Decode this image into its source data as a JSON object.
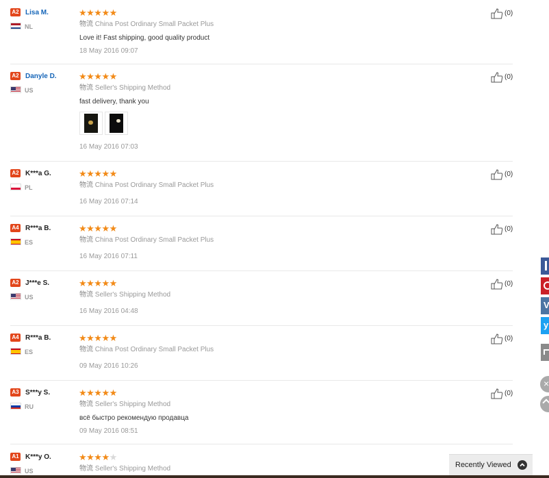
{
  "reviews": [
    {
      "level": "A2",
      "name": "Lisa M.",
      "name_link": true,
      "country": "NL",
      "flag": "nl",
      "rating": 5,
      "shipping_prefix": "物流",
      "shipping": "China Post Ordinary Small Packet Plus",
      "text": "Love it! Fast shipping, good quality product",
      "date": "18 May 2016 09:07",
      "helpful": "(0)"
    },
    {
      "level": "A2",
      "name": "Danyle D.",
      "name_link": true,
      "country": "US",
      "flag": "us",
      "rating": 5,
      "shipping_prefix": "物流",
      "shipping": "Seller's Shipping Method",
      "text": "fast delivery, thank you",
      "date": "16 May 2016 07:03",
      "helpful": "(0)",
      "photos": 2
    },
    {
      "level": "A2",
      "name": "K***a G.",
      "name_link": false,
      "country": "PL",
      "flag": "pl",
      "rating": 5,
      "shipping_prefix": "物流",
      "shipping": "China Post Ordinary Small Packet Plus",
      "text": "",
      "date": "16 May 2016 07:14",
      "helpful": "(0)"
    },
    {
      "level": "A4",
      "name": "R***a B.",
      "name_link": false,
      "country": "ES",
      "flag": "es",
      "rating": 5,
      "shipping_prefix": "物流",
      "shipping": "China Post Ordinary Small Packet Plus",
      "text": "",
      "date": "16 May 2016 07:11",
      "helpful": "(0)"
    },
    {
      "level": "A2",
      "name": "J***e S.",
      "name_link": false,
      "country": "US",
      "flag": "us",
      "rating": 5,
      "shipping_prefix": "物流",
      "shipping": "Seller's Shipping Method",
      "text": "",
      "date": "16 May 2016 04:48",
      "helpful": "(0)"
    },
    {
      "level": "A4",
      "name": "R***a B.",
      "name_link": false,
      "country": "ES",
      "flag": "es",
      "rating": 5,
      "shipping_prefix": "物流",
      "shipping": "China Post Ordinary Small Packet Plus",
      "text": "",
      "date": "09 May 2016 10:26",
      "helpful": "(0)"
    },
    {
      "level": "A3",
      "name": "S***y S.",
      "name_link": false,
      "country": "RU",
      "flag": "ru",
      "rating": 5,
      "shipping_prefix": "物流",
      "shipping": "Seller's Shipping Method",
      "text": "всё быстро рекомендую продавца",
      "date": "09 May 2016 08:51",
      "helpful": "(0)"
    },
    {
      "level": "A1",
      "name": "K***y O.",
      "name_link": false,
      "country": "US",
      "flag": "us",
      "rating": 4,
      "shipping_prefix": "物流",
      "shipping": "Seller's Shipping Method",
      "text": "",
      "date": "",
      "helpful": ""
    }
  ],
  "share_buttons": [
    {
      "icon": "facebook-icon",
      "color": "#3b5998"
    },
    {
      "icon": "pinterest-icon",
      "color": "#cb2027"
    },
    {
      "icon": "vk-icon",
      "color": "#4c75a3"
    },
    {
      "icon": "twitter-icon",
      "color": "#1da1f2"
    },
    {
      "icon": "share-icon",
      "color": "#8a8a8a"
    }
  ],
  "recently_viewed": {
    "label": "Recently Viewed"
  },
  "colors": {
    "star": "#f28a17",
    "level_badge": "#e2461b",
    "name_link": "#1565b8"
  }
}
